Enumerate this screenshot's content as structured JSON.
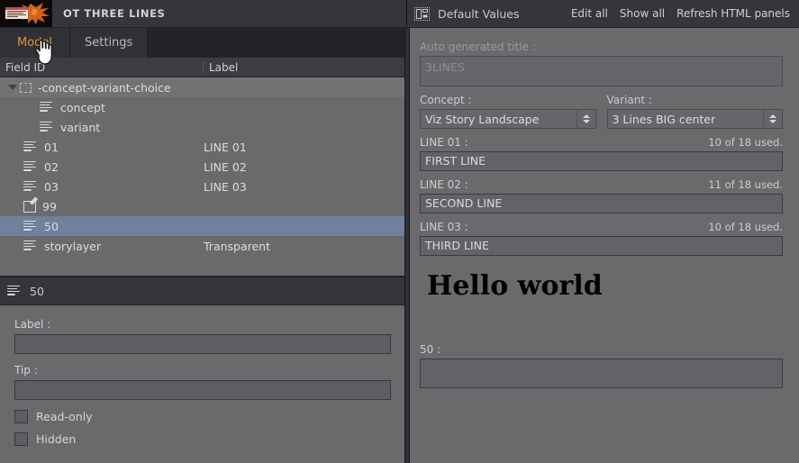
{
  "window": {
    "app_title": "OT THREE LINES",
    "logo_icon": "orange-splash-logo"
  },
  "tabs": [
    {
      "label": "Model",
      "active": true
    },
    {
      "label": "Settings",
      "active": false
    }
  ],
  "tree": {
    "columns": {
      "field_id": "Field ID",
      "label": "Label"
    },
    "rows": [
      {
        "field_id": "-concept-variant-choice",
        "label": "",
        "icon": "dashed-box-icon",
        "indent": 0,
        "caret": true,
        "selected": false
      },
      {
        "field_id": "concept",
        "label": "",
        "icon": "text-lines-icon",
        "indent": 2,
        "caret": false,
        "selected": false
      },
      {
        "field_id": "variant",
        "label": "",
        "icon": "text-lines-icon",
        "indent": 2,
        "caret": false,
        "selected": false
      },
      {
        "field_id": "01",
        "label": "LINE 01",
        "icon": "text-lines-icon",
        "indent": 1,
        "caret": false,
        "selected": false
      },
      {
        "field_id": "02",
        "label": "LINE 02",
        "icon": "text-lines-icon",
        "indent": 1,
        "caret": false,
        "selected": false
      },
      {
        "field_id": "03",
        "label": "LINE 03",
        "icon": "text-lines-icon",
        "indent": 1,
        "caret": false,
        "selected": false
      },
      {
        "field_id": "99",
        "label": "",
        "icon": "pencil-edit-icon",
        "indent": 1,
        "caret": false,
        "selected": false
      },
      {
        "field_id": "50",
        "label": "",
        "icon": "text-lines-icon",
        "indent": 1,
        "caret": false,
        "selected": true
      },
      {
        "field_id": "storylayer",
        "label": "Transparent",
        "icon": "text-lines-icon",
        "indent": 1,
        "caret": false,
        "selected": false
      }
    ]
  },
  "detail": {
    "header_title": "50",
    "header_icon": "text-lines-icon",
    "label_caption": "Label :",
    "label_value": "",
    "tip_caption": "Tip :",
    "tip_value": "",
    "readonly_caption": "Read-only",
    "readonly_checked": false,
    "hidden_caption": "Hidden",
    "hidden_checked": false
  },
  "right": {
    "header": {
      "icon": "panels-layout-icon",
      "title": "Default Values",
      "actions": [
        "Edit all",
        "Show all",
        "Refresh HTML panels"
      ]
    },
    "auto_title": {
      "caption": "Auto generated title :",
      "value": "3LINES"
    },
    "concept": {
      "caption": "Concept :",
      "value": "Viz Story Landscape"
    },
    "variant": {
      "caption": "Variant :",
      "value": "3 Lines BIG center"
    },
    "lines": [
      {
        "caption": "LINE 01 :",
        "counter": "10 of 18 used.",
        "value": "FIRST LINE"
      },
      {
        "caption": "LINE 02 :",
        "counter": "11 of 18 used.",
        "value": "SECOND LINE"
      },
      {
        "caption": "LINE 03 :",
        "counter": "10 of 18 used.",
        "value": "THIRD LINE"
      }
    ],
    "preview_text": "Hello world",
    "field50": {
      "caption": "50 :",
      "value": ""
    }
  },
  "colors": {
    "accent": "#e0912f",
    "selection": "#70809d",
    "panel_bg": "#6a6a6d",
    "chrome_bg": "#34363b",
    "dark_bg": "#2f3136"
  }
}
